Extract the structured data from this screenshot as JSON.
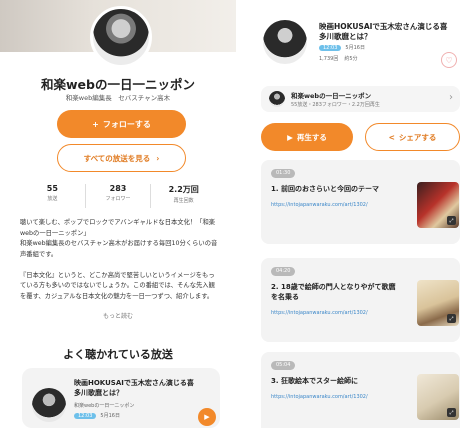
{
  "left": {
    "title": "和楽webの一日一ニッポン",
    "meta": "和楽web編集長　セバスチャン高木",
    "follow_label": "フォローする",
    "follow_icon": "+",
    "all_label": "すべての放送を見る",
    "all_icon": "›",
    "stats": [
      {
        "num": "55",
        "label": "放送"
      },
      {
        "num": "283",
        "label": "フォロワー"
      },
      {
        "num": "2.2万回",
        "label": "再生回数"
      }
    ],
    "description": "聴いて楽しむ、ポップでロックでアバンギャルドな日本文化！「和楽webの一日一ニッポン」\n和楽web編集長のセバスチャン高木がお届けする毎回10分くらいの音声番組です。\n\n『日本文化』というと、どこか高尚で堅苦しいというイメージをもっている方も多いのではないでしょうか。この番組では、そんな先入観を覆す、カジュアルな日本文化の魅力を一日一つずつ、紹介します。",
    "more_label": "もっと読む",
    "section_title": "よく聴かれている放送",
    "episode": {
      "title": "映画HOKUSAIで玉木宏さん演じる喜多川歌麿とは？",
      "channel": "和楽webの一日一ニッポン",
      "duration": "12:03",
      "date": "5月16日",
      "play_icon": "▶"
    }
  },
  "right": {
    "episode_title": "映画HOKUSAIで玉木宏さん演じる喜多川歌麿とは？",
    "duration": "12:03",
    "date": "5月16日",
    "plays": "1,739回",
    "length": "約5分",
    "heart_icon": "♡",
    "channel_name": "和楽webの一日一ニッポン",
    "channel_sub": "55放送・283フォロワー・2.2万回再生",
    "channel_arrow": "›",
    "play_label": "再生する",
    "share_label": "シェアする",
    "tracks": [
      {
        "time": "01:30",
        "title": "1. 前回のおさらいと今回のテーマ",
        "link": "https://intojapanwaraku.com/art/1302/"
      },
      {
        "time": "04:20",
        "title": "2. 18歳で絵師の門人となりやがて歌麿を名乗る",
        "link": "https://intojapanwaraku.com/art/1302/"
      },
      {
        "time": "05:04",
        "title": "3. 狂歌絵本でスター絵師に",
        "link": "https://intojapanwaraku.com/art/1302/"
      }
    ],
    "colors": {
      "accent": "#f2892a",
      "link": "#3a86c8",
      "pill": "#6ec0ea"
    }
  }
}
